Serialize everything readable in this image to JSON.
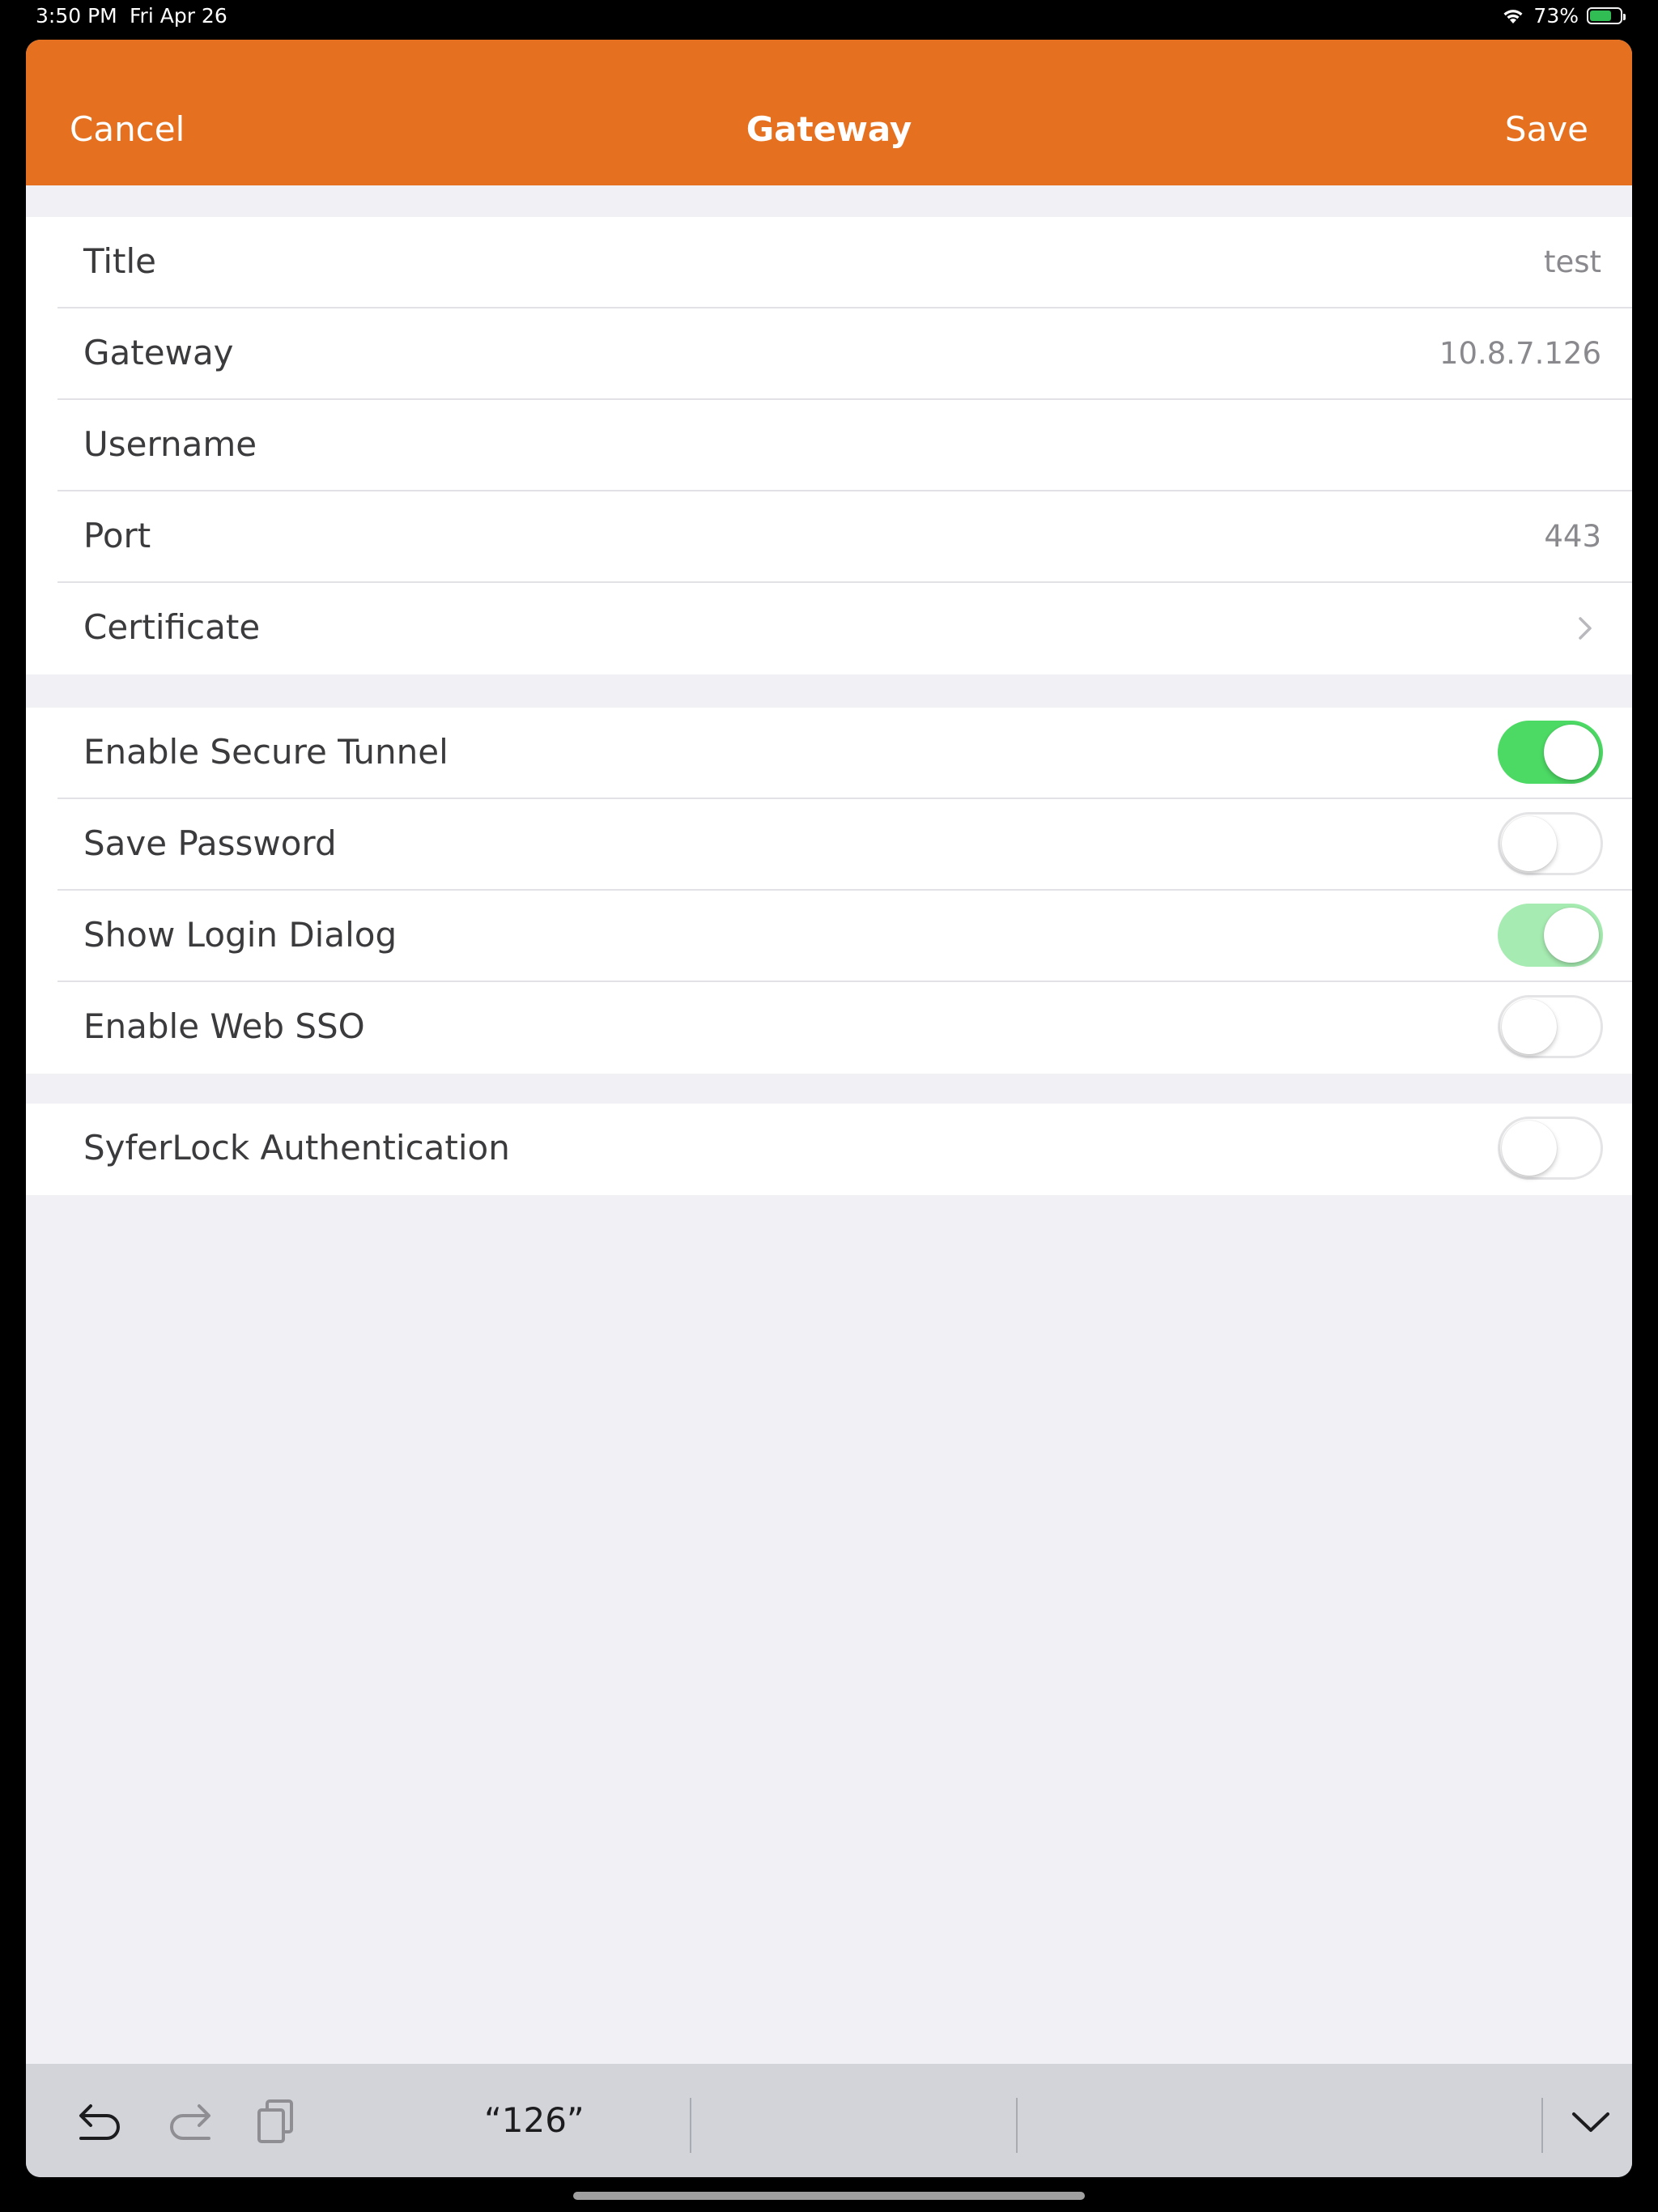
{
  "status_bar": {
    "time": "3:50 PM",
    "date": "Fri Apr 26",
    "battery_percent": "73%",
    "battery_level": 0.73,
    "battery_color": "#34c759"
  },
  "navbar": {
    "cancel_label": "Cancel",
    "title": "Gateway",
    "save_label": "Save",
    "color": "#e5701f"
  },
  "connection": {
    "title": {
      "label": "Title",
      "value": "test"
    },
    "gateway": {
      "label": "Gateway",
      "value": "10.8.7.126"
    },
    "username": {
      "label": "Username",
      "value": ""
    },
    "port": {
      "label": "Port",
      "value": "443"
    },
    "certificate": {
      "label": "Certificate",
      "icon": "chevron-right-icon"
    }
  },
  "options": {
    "secure_tunnel": {
      "label": "Enable Secure Tunnel",
      "on": true
    },
    "save_password": {
      "label": "Save Password",
      "on": false
    },
    "login_dialog": {
      "label": "Show Login Dialog",
      "on": true,
      "disabled": true
    },
    "web_sso": {
      "label": "Enable Web SSO",
      "on": false
    }
  },
  "auth": {
    "syferlock": {
      "label": "SyferLock Authentication",
      "on": false
    }
  },
  "keyboard_bar": {
    "undo_icon": "undo-icon",
    "redo_icon": "redo-icon",
    "paste_icon": "paste-icon",
    "suggestion": "“126”",
    "dismiss_icon": "chevron-down-icon"
  }
}
